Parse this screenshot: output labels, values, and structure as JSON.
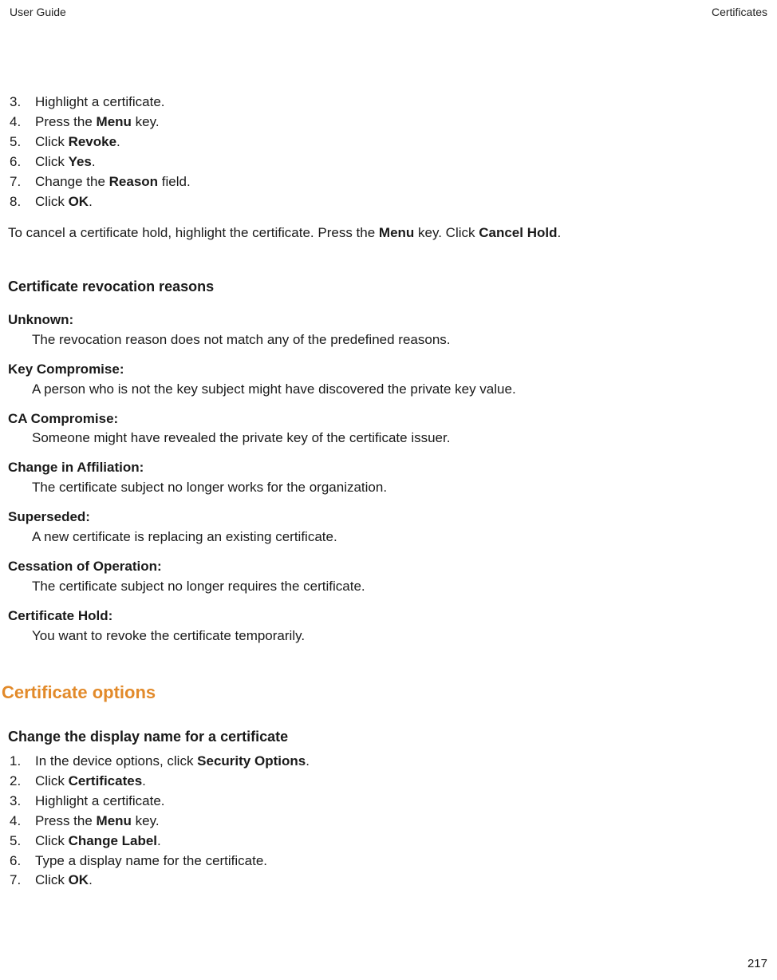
{
  "header": {
    "left": "User Guide",
    "right": "Certificates"
  },
  "stepsA": [
    {
      "num": "3.",
      "pre": "Highlight a certificate."
    },
    {
      "num": "4.",
      "pre": "Press the ",
      "bold": "Menu",
      "post": " key."
    },
    {
      "num": "5.",
      "pre": "Click ",
      "bold": "Revoke",
      "post": "."
    },
    {
      "num": "6.",
      "pre": "Click ",
      "bold": "Yes",
      "post": "."
    },
    {
      "num": "7.",
      "pre": "Change the ",
      "bold": "Reason",
      "post": " field."
    },
    {
      "num": "8.",
      "pre": "Click ",
      "bold": "OK",
      "post": "."
    }
  ],
  "cancelHold": {
    "p1": "To cancel a certificate hold, highlight the certificate. Press the ",
    "b1": "Menu",
    "p2": " key. Click ",
    "b2": "Cancel Hold",
    "p3": "."
  },
  "revocationHeading": "Certificate revocation reasons",
  "reasons": [
    {
      "term": "Unknown:",
      "def": "The revocation reason does not match any of the predefined reasons."
    },
    {
      "term": "Key Compromise:",
      "def": "A person who is not the key subject might have discovered the private key value."
    },
    {
      "term": "CA Compromise:",
      "def": "Someone might have revealed the private key of the certificate issuer."
    },
    {
      "term": "Change in Affiliation:",
      "def": "The certificate subject no longer works for the organization."
    },
    {
      "term": "Superseded:",
      "def": "A new certificate is replacing an existing certificate."
    },
    {
      "term": "Cessation of Operation:",
      "def": "The certificate subject no longer requires the certificate."
    },
    {
      "term": "Certificate Hold:",
      "def": "You want to revoke the certificate temporarily."
    }
  ],
  "optionsHeading": "Certificate options",
  "changeDisplayHeading": "Change the display name for a certificate",
  "stepsB": [
    {
      "num": "1.",
      "pre": "In the device options, click ",
      "bold": "Security Options",
      "post": "."
    },
    {
      "num": "2.",
      "pre": "Click ",
      "bold": "Certificates",
      "post": "."
    },
    {
      "num": "3.",
      "pre": "Highlight a certificate."
    },
    {
      "num": "4.",
      "pre": "Press the ",
      "bold": "Menu",
      "post": " key."
    },
    {
      "num": "5.",
      "pre": "Click ",
      "bold": "Change Label",
      "post": "."
    },
    {
      "num": "6.",
      "pre": "Type a display name for the certificate."
    },
    {
      "num": "7.",
      "pre": "Click ",
      "bold": "OK",
      "post": "."
    }
  ],
  "pageNumber": "217"
}
